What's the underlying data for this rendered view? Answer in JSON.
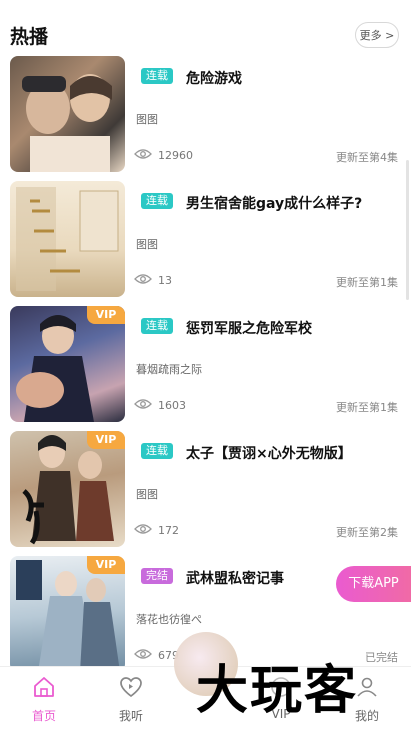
{
  "header": {
    "title": "热播",
    "more_label": "更多 >"
  },
  "items": [
    {
      "tag": "连载",
      "name": "危险游戏",
      "author": "图图",
      "views": "12960",
      "update": "更新至第4集",
      "vip": ""
    },
    {
      "tag": "连载",
      "name": "男生宿舍能gay成什么样子?",
      "author": "图图",
      "views": "13",
      "update": "更新至第1集",
      "vip": ""
    },
    {
      "tag": "连载",
      "name": "惩罚军服之危险军校",
      "author": "暮烟疏雨之际",
      "views": "1603",
      "update": "更新至第1集",
      "vip": "VIP"
    },
    {
      "tag": "连载",
      "name": "太子【贾诩×心外无物版】",
      "author": "图图",
      "views": "172",
      "update": "更新至第2集",
      "vip": "VIP"
    },
    {
      "tag": "完结",
      "name": "武林盟私密记事",
      "author": "落花也彷徨ぺ",
      "views": "679",
      "update": "已完结",
      "vip": "VIP"
    }
  ],
  "download_label": "下载APP",
  "tabs": [
    {
      "label": "首页"
    },
    {
      "label": "我听"
    },
    {
      "label": "VIP"
    },
    {
      "label": "我的"
    }
  ],
  "watermark": "大玩客",
  "colors": {
    "accent": "#ea5bd0",
    "serial_tag": "#2bc8c5",
    "done_tag": "#c86bdc",
    "vip_badge": "#f6a840"
  }
}
